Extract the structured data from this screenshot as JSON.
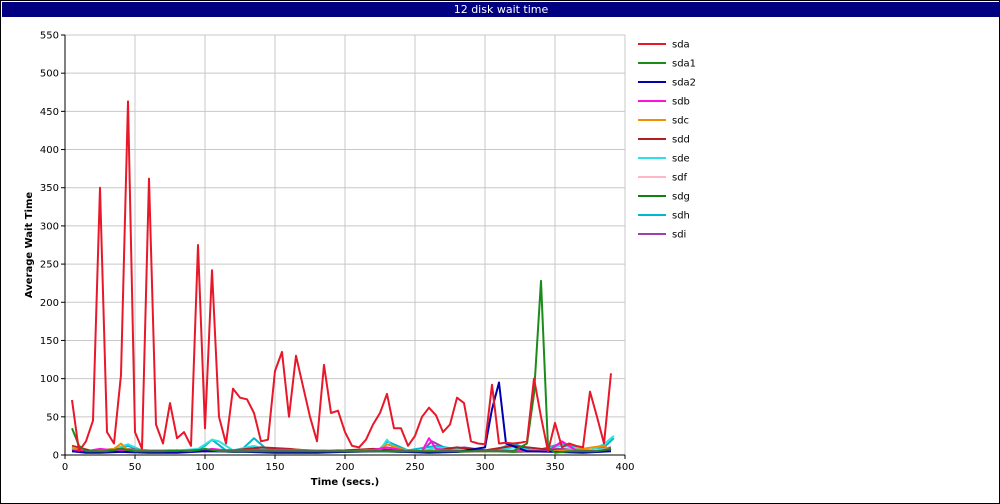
{
  "window": {
    "title": "12 disk wait time"
  },
  "chart_data": {
    "type": "line",
    "title": "12 disk wait time",
    "xlabel": "Time (secs.)",
    "ylabel": "Average Wait Time",
    "xlim": [
      0,
      400
    ],
    "ylim": [
      0,
      550
    ],
    "x_ticks": [
      0,
      50,
      100,
      150,
      200,
      250,
      300,
      350,
      400
    ],
    "y_ticks": [
      0,
      50,
      100,
      150,
      200,
      250,
      300,
      350,
      400,
      450,
      500,
      550
    ],
    "grid": true,
    "legend_position": "right",
    "series": [
      {
        "name": "sda",
        "color": "#e8182a",
        "x": [
          5,
          10,
          15,
          20,
          25,
          30,
          35,
          40,
          45,
          50,
          55,
          60,
          65,
          70,
          75,
          80,
          85,
          90,
          95,
          100,
          105,
          110,
          115,
          120,
          125,
          130,
          135,
          140,
          145,
          150,
          155,
          160,
          165,
          170,
          175,
          180,
          185,
          190,
          195,
          200,
          205,
          210,
          215,
          220,
          225,
          230,
          235,
          240,
          245,
          250,
          255,
          260,
          265,
          270,
          275,
          280,
          285,
          290,
          295,
          300,
          305,
          310,
          315,
          320,
          325,
          330,
          335,
          340,
          345,
          350,
          355,
          360,
          365,
          370,
          375,
          380,
          385,
          390
        ],
        "y": [
          72,
          5,
          18,
          45,
          350,
          30,
          15,
          105,
          463,
          30,
          8,
          362,
          40,
          15,
          68,
          22,
          30,
          12,
          275,
          35,
          242,
          50,
          15,
          87,
          75,
          73,
          55,
          18,
          20,
          110,
          135,
          50,
          130,
          90,
          50,
          18,
          118,
          55,
          58,
          30,
          12,
          10,
          20,
          40,
          55,
          80,
          35,
          35,
          12,
          25,
          50,
          62,
          52,
          30,
          40,
          75,
          68,
          18,
          15,
          14,
          92,
          15,
          16,
          15,
          16,
          18,
          100,
          50,
          5,
          42,
          10,
          15,
          12,
          10,
          83,
          50,
          15,
          107
        ]
      },
      {
        "name": "sda1",
        "color": "#1a8c1a",
        "x": [
          5,
          10,
          15,
          20,
          30,
          40,
          50,
          60,
          70,
          80,
          90,
          100,
          110,
          120,
          130,
          140,
          150,
          160,
          170,
          180,
          190,
          200,
          210,
          220,
          230,
          240,
          250,
          260,
          270,
          280,
          290,
          300,
          310,
          320,
          330,
          335,
          340,
          345,
          350,
          360,
          370,
          380,
          390
        ],
        "y": [
          35,
          12,
          5,
          5,
          5,
          8,
          5,
          5,
          5,
          6,
          5,
          8,
          5,
          5,
          5,
          5,
          5,
          5,
          5,
          5,
          5,
          5,
          5,
          5,
          5,
          5,
          5,
          5,
          5,
          5,
          5,
          5,
          5,
          5,
          15,
          80,
          228,
          10,
          3,
          5,
          5,
          5,
          8
        ]
      },
      {
        "name": "sda2",
        "color": "#0000b0",
        "x": [
          5,
          15,
          25,
          40,
          60,
          80,
          100,
          130,
          150,
          180,
          200,
          230,
          260,
          280,
          300,
          305,
          310,
          315,
          330,
          350,
          370,
          390
        ],
        "y": [
          5,
          3,
          3,
          4,
          3,
          3,
          5,
          4,
          3,
          3,
          4,
          5,
          3,
          4,
          10,
          60,
          95,
          15,
          5,
          4,
          3,
          5
        ]
      },
      {
        "name": "sdb",
        "color": "#ff10e0",
        "x": [
          5,
          15,
          25,
          35,
          45,
          55,
          75,
          95,
          105,
          115,
          135,
          155,
          175,
          195,
          215,
          230,
          245,
          255,
          260,
          265,
          275,
          285,
          295,
          310,
          325,
          345,
          355,
          365,
          375,
          385,
          390
        ],
        "y": [
          6,
          5,
          8,
          6,
          5,
          5,
          6,
          5,
          8,
          6,
          6,
          7,
          6,
          5,
          5,
          10,
          5,
          5,
          22,
          8,
          6,
          5,
          5,
          6,
          5,
          5,
          18,
          6,
          5,
          6,
          8
        ]
      },
      {
        "name": "sdc",
        "color": "#f09000",
        "x": [
          5,
          15,
          25,
          35,
          40,
          45,
          65,
          85,
          105,
          125,
          145,
          165,
          185,
          205,
          225,
          230,
          245,
          265,
          285,
          305,
          325,
          345,
          365,
          385,
          390
        ],
        "y": [
          10,
          5,
          6,
          8,
          15,
          6,
          6,
          5,
          6,
          5,
          5,
          7,
          5,
          5,
          7,
          14,
          5,
          6,
          5,
          5,
          6,
          5,
          7,
          12,
          6
        ]
      },
      {
        "name": "sdd",
        "color": "#b02020",
        "x": [
          5,
          20,
          40,
          60,
          80,
          100,
          120,
          140,
          160,
          180,
          200,
          220,
          240,
          260,
          280,
          300,
          320,
          340,
          360,
          380,
          390
        ],
        "y": [
          12,
          5,
          8,
          6,
          5,
          7,
          6,
          10,
          8,
          5,
          6,
          8,
          6,
          5,
          10,
          6,
          12,
          8,
          6,
          5,
          8
        ]
      },
      {
        "name": "sde",
        "color": "#30e0e8",
        "x": [
          5,
          15,
          25,
          35,
          45,
          55,
          75,
          95,
          105,
          110,
          120,
          135,
          145,
          165,
          185,
          205,
          225,
          230,
          235,
          255,
          265,
          285,
          305,
          320,
          335,
          355,
          375,
          385,
          392
        ],
        "y": [
          8,
          5,
          6,
          8,
          14,
          6,
          5,
          8,
          20,
          18,
          6,
          12,
          6,
          5,
          6,
          5,
          6,
          20,
          8,
          5,
          10,
          6,
          5,
          10,
          5,
          12,
          6,
          14,
          25
        ]
      },
      {
        "name": "sdf",
        "color": "#ffb8c8",
        "x": [
          5,
          15,
          25,
          35,
          45,
          55,
          75,
          95,
          115,
          135,
          155,
          175,
          195,
          215,
          235,
          255,
          275,
          295,
          315,
          335,
          355,
          375,
          390
        ],
        "y": [
          6,
          5,
          5,
          6,
          5,
          6,
          5,
          5,
          6,
          5,
          7,
          5,
          5,
          6,
          5,
          5,
          6,
          5,
          5,
          6,
          5,
          6,
          8
        ]
      },
      {
        "name": "sdg",
        "color": "#108010",
        "x": [
          5,
          20,
          40,
          60,
          80,
          100,
          120,
          140,
          160,
          180,
          200,
          220,
          240,
          260,
          280,
          300,
          320,
          340,
          360,
          380,
          390
        ],
        "y": [
          5,
          4,
          5,
          4,
          5,
          6,
          4,
          5,
          4,
          5,
          4,
          5,
          4,
          5,
          4,
          5,
          4,
          5,
          4,
          5,
          6
        ]
      },
      {
        "name": "sdh",
        "color": "#00b8c8",
        "x": [
          5,
          15,
          25,
          35,
          45,
          55,
          75,
          95,
          100,
          105,
          115,
          125,
          135,
          145,
          165,
          185,
          205,
          225,
          230,
          245,
          265,
          285,
          305,
          320,
          335,
          355,
          375,
          385,
          392
        ],
        "y": [
          10,
          5,
          6,
          8,
          12,
          5,
          5,
          7,
          12,
          20,
          6,
          5,
          22,
          6,
          5,
          6,
          5,
          8,
          18,
          6,
          12,
          6,
          5,
          15,
          5,
          15,
          6,
          10,
          22
        ]
      },
      {
        "name": "sdi",
        "color": "#a040b0",
        "x": [
          5,
          15,
          25,
          35,
          45,
          55,
          75,
          95,
          115,
          135,
          155,
          175,
          195,
          215,
          235,
          255,
          262,
          275,
          285,
          305,
          325,
          355,
          375,
          390
        ],
        "y": [
          8,
          5,
          6,
          7,
          5,
          6,
          5,
          6,
          5,
          8,
          6,
          5,
          6,
          5,
          6,
          5,
          18,
          6,
          10,
          5,
          6,
          8,
          5,
          10
        ]
      }
    ]
  }
}
